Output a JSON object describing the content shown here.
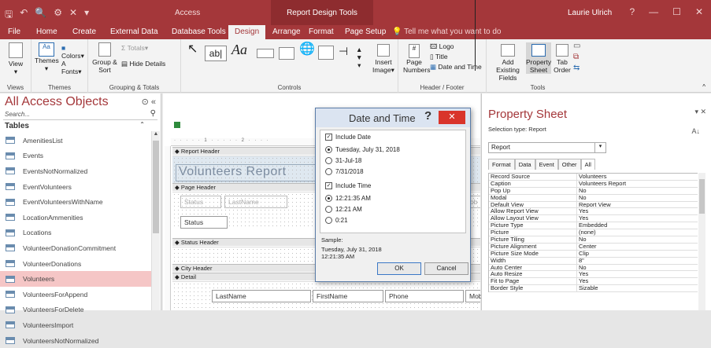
{
  "titlebar": {
    "app": "Access",
    "context": "Report Design Tools",
    "user": "Laurie Ulrich",
    "help": "?",
    "ctrls": [
      "—",
      "☐",
      "✕"
    ]
  },
  "tabs": [
    "File",
    "Home",
    "Create",
    "External Data",
    "Database Tools",
    "Design",
    "Arrange",
    "Format",
    "Page Setup",
    "Tell me what you want to do"
  ],
  "ribbon": {
    "views": {
      "label": "View",
      "group": "Views"
    },
    "themes": {
      "themes": "Themes",
      "colors": "Colors",
      "fonts": "Fonts",
      "group": "Themes"
    },
    "grouping": {
      "group_sort": "Group & Sort",
      "totals": "Totals",
      "hide": "Hide Details",
      "group": "Grouping & Totals"
    },
    "controls": {
      "group": "Controls",
      "text": "ab|",
      "aa": "Aa"
    },
    "insert": {
      "image": "Insert Image"
    },
    "header": {
      "page_numbers": "Page Numbers",
      "logo": "Logo",
      "title": "Title",
      "date_time": "Date and Time",
      "group": "Header / Footer"
    },
    "tools": {
      "add_fields": "Add Existing Fields",
      "property_sheet": "Property Sheet",
      "tab_order": "Tab Order",
      "group": "Tools"
    }
  },
  "nav": {
    "title": "All Access Objects",
    "search": "Search...",
    "section": "Tables",
    "items": [
      "AmenitiesList",
      "Events",
      "EventsNotNormalized",
      "EventVolunteers",
      "EventVolunteersWithName",
      "LocationAmmenities",
      "Locations",
      "VolunteerDonationCommitment",
      "VolunteerDonations",
      "Volunteers",
      "VolunteersForAppend",
      "VolunteersForDelete",
      "VolunteersImport",
      "VolunteersNotNormalized"
    ],
    "selected": "Volunteers"
  },
  "design": {
    "ruler": "· · · · · 1 · · · · · 2 · · · ·",
    "report_header": "Report Header",
    "title": "Volunteers Report",
    "page_header": "Page Header",
    "status_lbl": "Status",
    "lastname_lbl": "LastName",
    "status_hdr": "Status Header",
    "status_ctl": "Status",
    "city_header": "City Header",
    "detail": "Detail",
    "d_lastname": "LastName",
    "d_firstname": "FirstName",
    "d_phone": "Phone",
    "d_mob": "Mob",
    "cut_label": "ob"
  },
  "dialog": {
    "title": "Date and Time",
    "include_date": "Include Date",
    "date_formats": [
      "Tuesday, July 31, 2018",
      "31-Jul-18",
      "7/31/2018"
    ],
    "include_time": "Include Time",
    "time_formats": [
      "12:21:35 AM",
      "12:21 AM",
      "0:21"
    ],
    "sample_label": "Sample:",
    "sample_date": "Tuesday, July 31, 2018",
    "sample_time": "12:21:35 AM",
    "ok": "OK",
    "cancel": "Cancel"
  },
  "props": {
    "title": "Property Sheet",
    "selection": "Selection type:  Report",
    "object": "Report",
    "tabs": [
      "Format",
      "Data",
      "Event",
      "Other",
      "All"
    ],
    "active_tab": "All",
    "rows": [
      [
        "Record Source",
        "Volunteers"
      ],
      [
        "Caption",
        "Volunteers Report"
      ],
      [
        "Pop Up",
        "No"
      ],
      [
        "Modal",
        "No"
      ],
      [
        "Default View",
        "Report View"
      ],
      [
        "Allow Report View",
        "Yes"
      ],
      [
        "Allow Layout View",
        "Yes"
      ],
      [
        "Picture Type",
        "Embedded"
      ],
      [
        "Picture",
        "(none)"
      ],
      [
        "Picture Tiling",
        "No"
      ],
      [
        "Picture Alignment",
        "Center"
      ],
      [
        "Picture Size Mode",
        "Clip"
      ],
      [
        "Width",
        "8\""
      ],
      [
        "Auto Center",
        "No"
      ],
      [
        "Auto Resize",
        "Yes"
      ],
      [
        "Fit to Page",
        "Yes"
      ],
      [
        "Border Style",
        "Sizable"
      ]
    ]
  },
  "colors": {
    "accent": "#a4373a",
    "selected": "#f5c6c6"
  }
}
